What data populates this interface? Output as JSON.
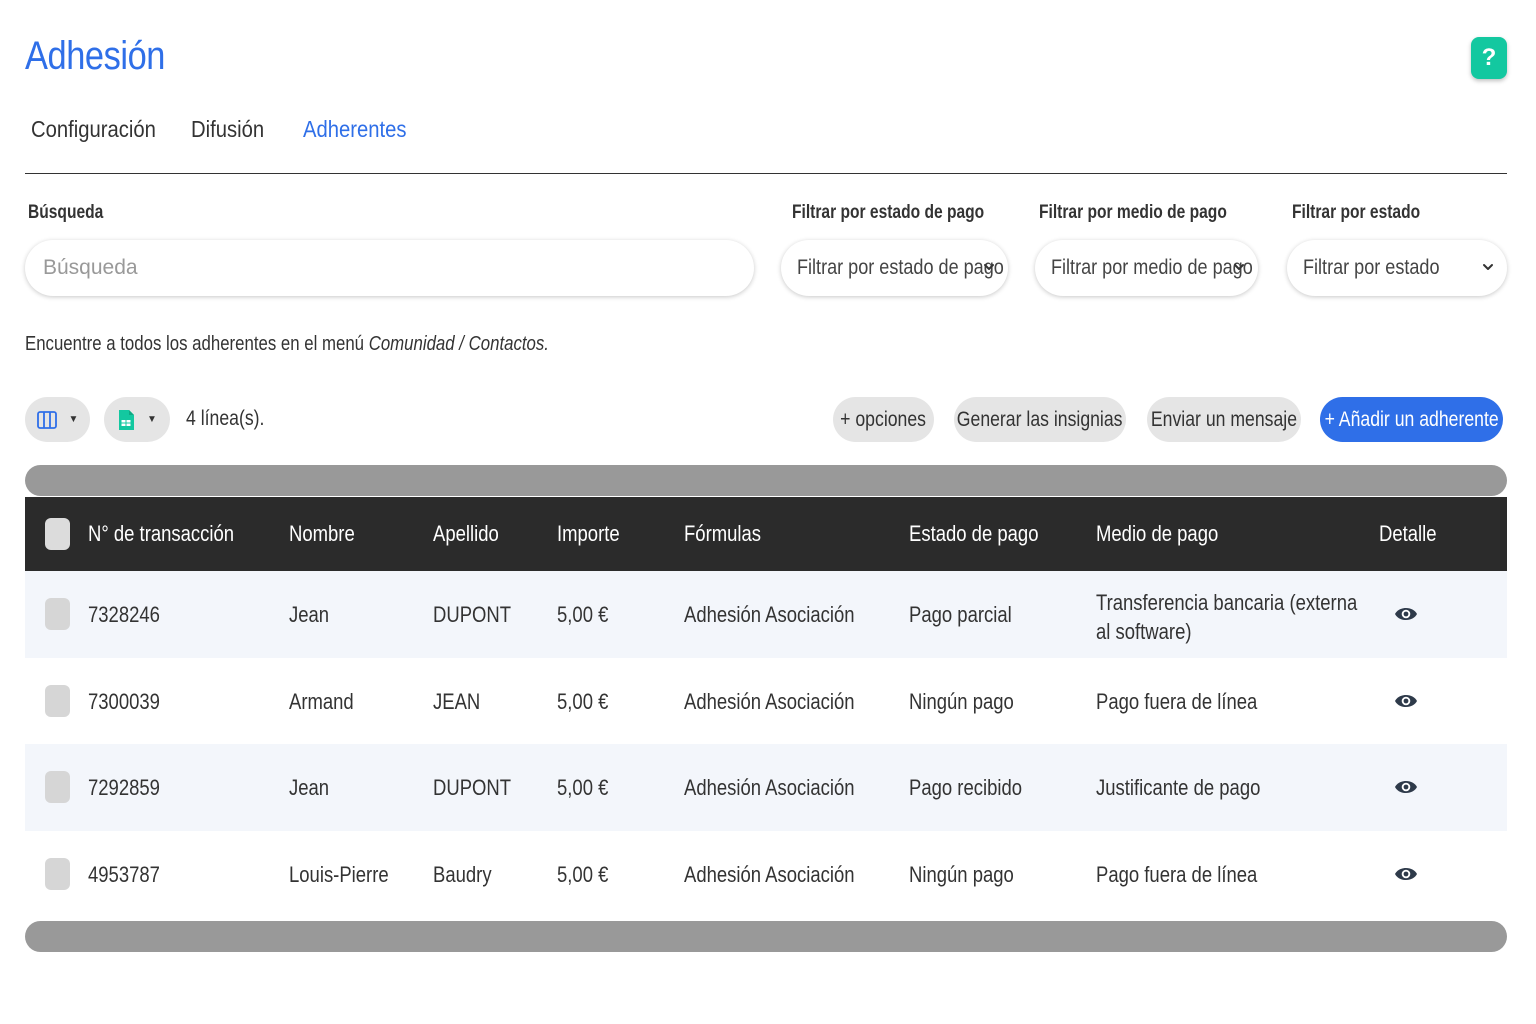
{
  "page": {
    "title": "Adhesión",
    "help_label": "?"
  },
  "tabs": [
    {
      "label": "Configuración",
      "active": false
    },
    {
      "label": "Difusión",
      "active": false
    },
    {
      "label": "Adherentes",
      "active": true
    }
  ],
  "filters": {
    "search": {
      "label": "Búsqueda",
      "placeholder": "Búsqueda",
      "value": ""
    },
    "payment_status": {
      "label": "Filtrar por estado de pago",
      "selected": "Filtrar por estado de pago"
    },
    "payment_method": {
      "label": "Filtrar por medio de pago",
      "selected": "Filtrar por medio de pago"
    },
    "status": {
      "label": "Filtrar por estado",
      "selected": "Filtrar por estado"
    }
  },
  "note": {
    "prefix": "Encuentre a todos los adherentes en el menú ",
    "emphasis": "Comunidad / Contactos."
  },
  "toolbar": {
    "line_count": "4 línea(s).",
    "options_label": "+ opciones",
    "badges_label": "Generar las insignias",
    "message_label": "Enviar un mensaje",
    "add_label": "+ Añadir un adherente",
    "colors": {
      "primary": "#2f6fe8",
      "pill": "#e5e5e5",
      "export": "#13c8a0"
    }
  },
  "table": {
    "headers": [
      "N° de transacción",
      "Nombre",
      "Apellido",
      "Importe",
      "Fórmulas",
      "Estado de pago",
      "Medio de pago",
      "Detalle"
    ],
    "rows": [
      {
        "transaction": "7328246",
        "first": "Jean",
        "last": "DUPONT",
        "amount": "5,00 €",
        "formula": "Adhesión Asociación",
        "status": "Pago parcial",
        "method1": "Transferencia bancaria (externa",
        "method2": "al software)"
      },
      {
        "transaction": "7300039",
        "first": "Armand",
        "last": "JEAN",
        "amount": "5,00 €",
        "formula": "Adhesión Asociación",
        "status": "Ningún pago",
        "method1": "Pago fuera de línea",
        "method2": ""
      },
      {
        "transaction": "7292859",
        "first": "Jean",
        "last": "DUPONT",
        "amount": "5,00 €",
        "formula": "Adhesión Asociación",
        "status": "Pago recibido",
        "method1": "Justificante de pago",
        "method2": ""
      },
      {
        "transaction": "4953787",
        "first": "Louis-Pierre",
        "last": "Baudry",
        "amount": "5,00 €",
        "formula": "Adhesión Asociación",
        "status": "Ningún pago",
        "method1": "Pago fuera de línea",
        "method2": ""
      }
    ]
  }
}
